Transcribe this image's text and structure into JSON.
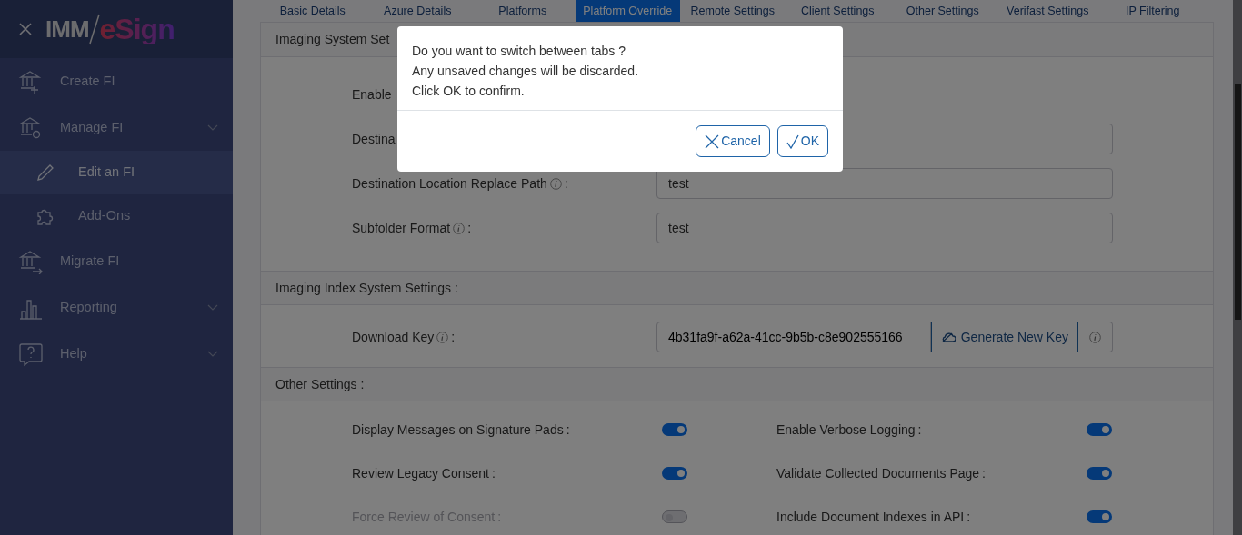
{
  "sidebar": {
    "brand": {
      "left": "IMM",
      "right": "eSign"
    },
    "items": [
      {
        "label": "Create FI",
        "expandable": false
      },
      {
        "label": "Manage FI",
        "expandable": true,
        "children": [
          {
            "label": "Edit an FI",
            "selected": true
          },
          {
            "label": "Add-Ons",
            "selected": false
          }
        ]
      },
      {
        "label": "Migrate FI",
        "expandable": false
      },
      {
        "label": "Reporting",
        "expandable": true
      },
      {
        "label": "Help",
        "expandable": true
      }
    ]
  },
  "tabs": [
    {
      "label": "Basic Details",
      "selected": false
    },
    {
      "label": "Azure Details",
      "selected": false
    },
    {
      "label": "Platforms",
      "selected": false
    },
    {
      "label": "Platform Override",
      "selected": true
    },
    {
      "label": "Remote Settings",
      "selected": false
    },
    {
      "label": "Client Settings",
      "selected": false
    },
    {
      "label": "Other Settings",
      "selected": false
    },
    {
      "label": "Verifast Settings",
      "selected": false
    },
    {
      "label": "IP Filtering",
      "selected": false
    }
  ],
  "sections": [
    {
      "title": "Imaging System Set",
      "kind": "form",
      "rows": [
        {
          "kind": "blank",
          "label": "Enable"
        },
        {
          "kind": "text",
          "label": "Destina"
        },
        {
          "kind": "text",
          "label": "Destination Location Replace Path",
          "info": true,
          "suffix": ":",
          "value": "test"
        },
        {
          "kind": "text",
          "label": "Subfolder Format",
          "info": true,
          "suffix": ":",
          "value": "test"
        }
      ]
    },
    {
      "title": "Imaging Index System Settings :",
      "kind": "form",
      "rows": [
        {
          "kind": "key",
          "label": "Download Key",
          "info": true,
          "suffix": ":",
          "value": "4b31fa9f-a62a-41cc-9b5b-c8e902555166",
          "button": "Generate New Key"
        }
      ]
    },
    {
      "title": "Other Settings :",
      "kind": "toggles",
      "rows": [
        {
          "label": "Display Messages on Signature Pads",
          "suffix": ":",
          "on": true,
          "disabled": false
        },
        {
          "label": "Enable Verbose Logging",
          "suffix": ":",
          "on": true,
          "disabled": false
        },
        {
          "label": "Review Legacy Consent",
          "suffix": ":",
          "on": true,
          "disabled": false
        },
        {
          "label": "Validate Collected Documents Page",
          "suffix": ":",
          "on": true,
          "disabled": false
        },
        {
          "label": "Force Review of Consent",
          "suffix": ":",
          "on": false,
          "disabled": true
        },
        {
          "label": "Include Document Indexes in API",
          "suffix": ":",
          "on": true,
          "disabled": false
        }
      ]
    }
  ],
  "dialog": {
    "lines": [
      "Do you want to switch between tabs ?",
      "Any unsaved changes will be discarded.",
      "Click OK to confirm."
    ],
    "buttons": [
      {
        "label": "Cancel",
        "kind": "cancel"
      },
      {
        "label": "OK",
        "kind": "ok"
      }
    ]
  }
}
